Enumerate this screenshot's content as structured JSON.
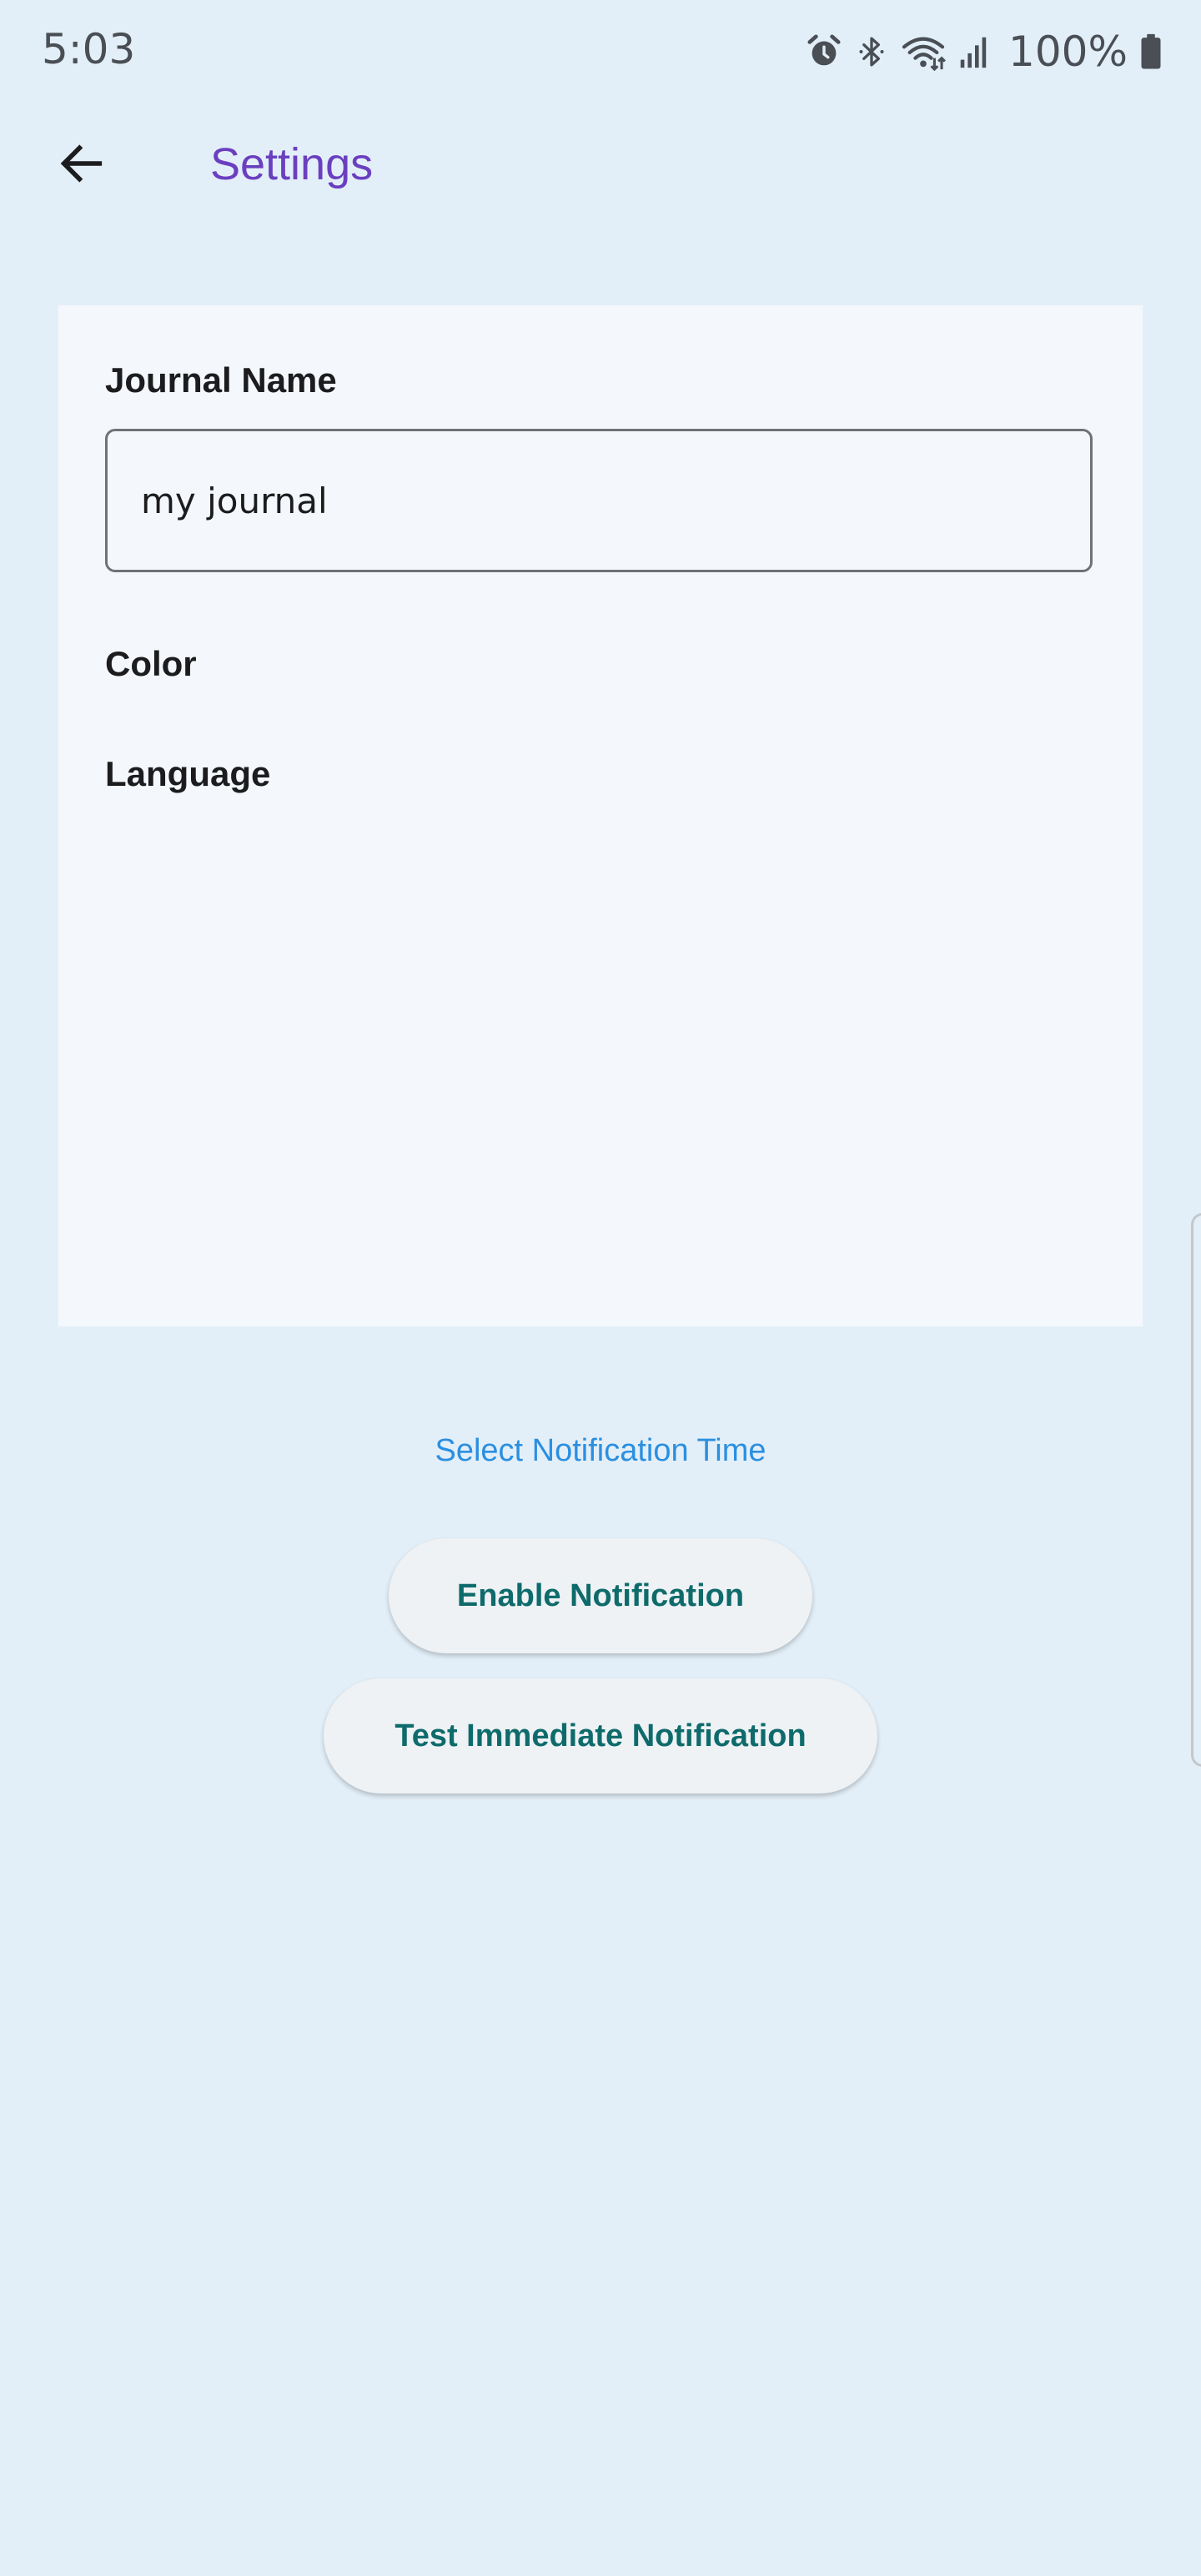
{
  "status_bar": {
    "time": "5:03",
    "battery_percent": "100%",
    "icons": [
      "alarm-icon",
      "bluetooth-icon",
      "wifi-icon",
      "signal-icon",
      "battery-icon"
    ]
  },
  "app_bar": {
    "title": "Settings",
    "back_icon": "arrow-back-icon"
  },
  "form": {
    "journal_name_label": "Journal Name",
    "journal_name_value": "my journal",
    "color_label": "Color",
    "language_label": "Language"
  },
  "actions": {
    "select_time_label": "Select Notification Time",
    "enable_label": "Enable Notification",
    "test_label": "Test Immediate Notification"
  },
  "colors": {
    "background": "#e3eff8",
    "card": "#f4f8fc",
    "title": "#6a3fbf",
    "link": "#2b8fe0",
    "button_text": "#0f6b6b"
  }
}
